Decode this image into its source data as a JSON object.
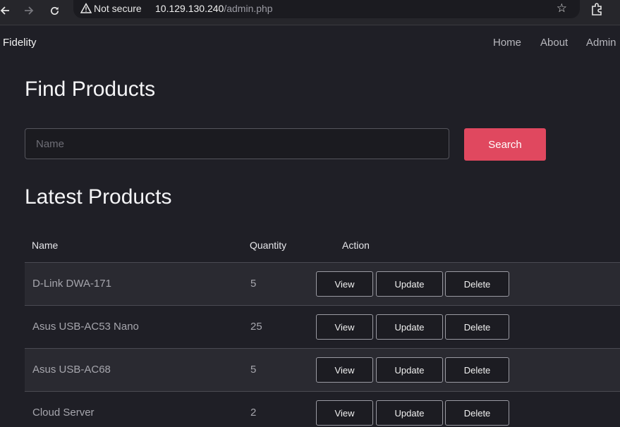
{
  "browser": {
    "not_secure_label": "Not secure",
    "host": "10.129.130.240",
    "path": "/admin.php",
    "icons": [
      "back-icon",
      "forward-icon",
      "reload-icon",
      "warning-icon",
      "star-icon",
      "extensions-icon"
    ]
  },
  "navbar": {
    "brand": "Fidelity",
    "links": [
      "Home",
      "About",
      "Admin"
    ]
  },
  "find": {
    "title": "Find Products",
    "placeholder": "Name",
    "value": "",
    "button": "Search",
    "button_color": "#e0485f"
  },
  "latest": {
    "title": "Latest Products",
    "columns": [
      "Name",
      "Quantity",
      "Action"
    ],
    "rows": [
      {
        "name": "D-Link DWA-171",
        "quantity": "5"
      },
      {
        "name": "Asus USB-AC53 Nano",
        "quantity": "25"
      },
      {
        "name": "Asus USB-AC68",
        "quantity": "5"
      },
      {
        "name": "Cloud Server",
        "quantity": "2"
      }
    ],
    "actions": {
      "view": "View",
      "update": "Update",
      "delete": "Delete"
    }
  }
}
